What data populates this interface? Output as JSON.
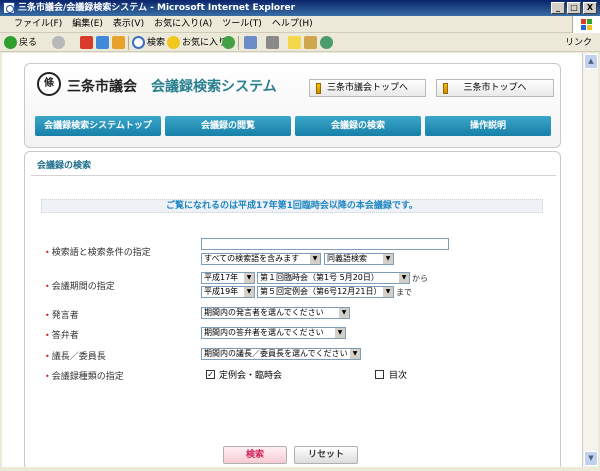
{
  "window": {
    "title": "三条市議会/会議録検索システム - Microsoft Internet Explorer",
    "buttons": [
      "_",
      "□",
      "X"
    ]
  },
  "menu": [
    "ファイル(F)",
    "編集(E)",
    "表示(V)",
    "お気に入り(A)",
    "ツール(T)",
    "ヘルプ(H)"
  ],
  "toolbar": {
    "back": "戻る",
    "search": "検索",
    "favorites": "お気に入り",
    "links": "リンク"
  },
  "header": {
    "logo_char": "條",
    "council_name": "三条市議会",
    "system_name": "会議録検索システム",
    "link_council_top": "三条市議会トップへ",
    "link_city_top": "三条市トップへ"
  },
  "nav": [
    "会議録検索システムトップ",
    "会議録の閲覧",
    "会議録の検索",
    "操作説明"
  ],
  "search": {
    "title": "会議録の検索",
    "notice": "ご覧になれるのは平成17年第1回臨時会以降の本会議録です。",
    "keyword_label": "検索語と検索条件の指定",
    "keyword_value": "",
    "keyword_mode": "すべての検索語を含みます",
    "synonym_mode": "同義語検索",
    "period_label": "会議期間の指定",
    "from_year": "平成17年",
    "from_session": "第１回臨時会（第1号 5月20日）",
    "from_suffix": "から",
    "to_year": "平成19年",
    "to_session": "第５回定例会（第6号12月21日）",
    "to_suffix": "まで",
    "speaker_label": "発言者",
    "speaker_value": "期間内の発言者を選んでください",
    "answerer_label": "答弁者",
    "answerer_value": "期間内の答弁者を選んでください",
    "chair_label": "議長／委員長",
    "chair_value": "期間内の議長／委員長を選んでください",
    "type_label": "会議録種類の指定",
    "type_regular": "定例会・臨時会",
    "type_regular_checked": true,
    "type_index": "目次",
    "type_index_checked": false,
    "checkmark": "✓",
    "search_button": "検索",
    "reset_button": "リセット"
  }
}
